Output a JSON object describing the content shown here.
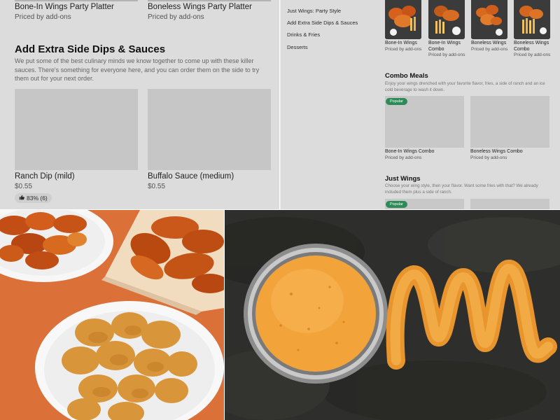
{
  "left_panel": {
    "top_items": [
      {
        "name": "Bone-In Wings Party Platter",
        "price": "Priced by add-ons"
      },
      {
        "name": "Boneless Wings Party Platter",
        "price": "Priced by add-ons"
      }
    ],
    "section": {
      "title": "Add Extra Side Dips & Sauces",
      "description": "We put some of the best culinary minds we know together to come up with these killer sauces. There's something for everyone here, and you can order them on the side to try them out for your next order."
    },
    "items": [
      {
        "name": "Ranch Dip (mild)",
        "price": "$0.55",
        "rating": "83% (6)"
      },
      {
        "name": "Buffalo Sauce (medium)",
        "price": "$0.55"
      }
    ]
  },
  "right_panel": {
    "nav": [
      "Just Wings: Party Style",
      "Add Extra Side Dips & Sauces",
      "Drinks & Fries",
      "Desserts"
    ],
    "thumbs": [
      {
        "name": "Bone-In Wings",
        "price": "Priced by add-ons"
      },
      {
        "name": "Bone-In Wings Combo",
        "price": "Priced by add-ons"
      },
      {
        "name": "Boneless Wings",
        "price": "Priced by add-ons"
      },
      {
        "name": "Boneless Wings Combo",
        "price": "Priced by add-ons"
      }
    ],
    "combo": {
      "title": "Combo Meals",
      "description": "Enjoy your wings drenched with your favorite flavor, fries, a side of ranch and an ice cold beverage to wash it down.",
      "badge": "Popular",
      "items": [
        {
          "name": "Bone-In Wings Combo",
          "price": "Priced by add-ons"
        },
        {
          "name": "Boneless Wings Combo",
          "price": "Priced by add-ons"
        }
      ]
    },
    "just_wings": {
      "title": "Just Wings",
      "description": "Choose your wing style, then your flavor. Want some fries with that? We already included them plus a side of ranch.",
      "badge": "Popular"
    }
  },
  "icons": {
    "rating": "thumbs-up-icon"
  },
  "colors": {
    "panel_bg": "#dcdcdc",
    "placeholder": "#c6c6c6",
    "badge": "#2e8b57",
    "sauce": "#f2a33a",
    "backdrop_orange": "#e3793f"
  }
}
